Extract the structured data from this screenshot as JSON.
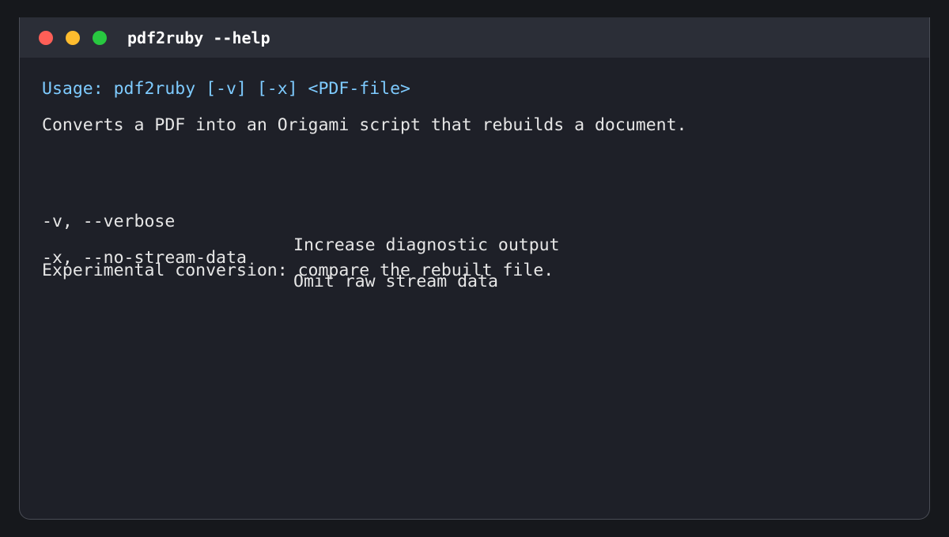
{
  "window": {
    "title": "pdf2ruby --help",
    "controls": {
      "close_color": "#ff5f57",
      "minimize_color": "#febc2e",
      "maximize_color": "#28c840"
    }
  },
  "terminal": {
    "usage_line": "Usage: pdf2ruby [-v] [-x] <PDF-file>",
    "description": "Converts a PDF into an Origami script that rebuilds a document.",
    "options": [
      {
        "flag": "-v, --verbose",
        "description": "Increase diagnostic output"
      },
      {
        "flag": "-x, --no-stream-data",
        "description": "Omit raw stream data"
      }
    ],
    "note": "Experimental conversion: compare the rebuilt file.",
    "colors": {
      "usage_text": "#7ecbff",
      "body_text": "#e6e6e6",
      "background": "#1e2028",
      "titlebar": "#2b2e37"
    }
  }
}
